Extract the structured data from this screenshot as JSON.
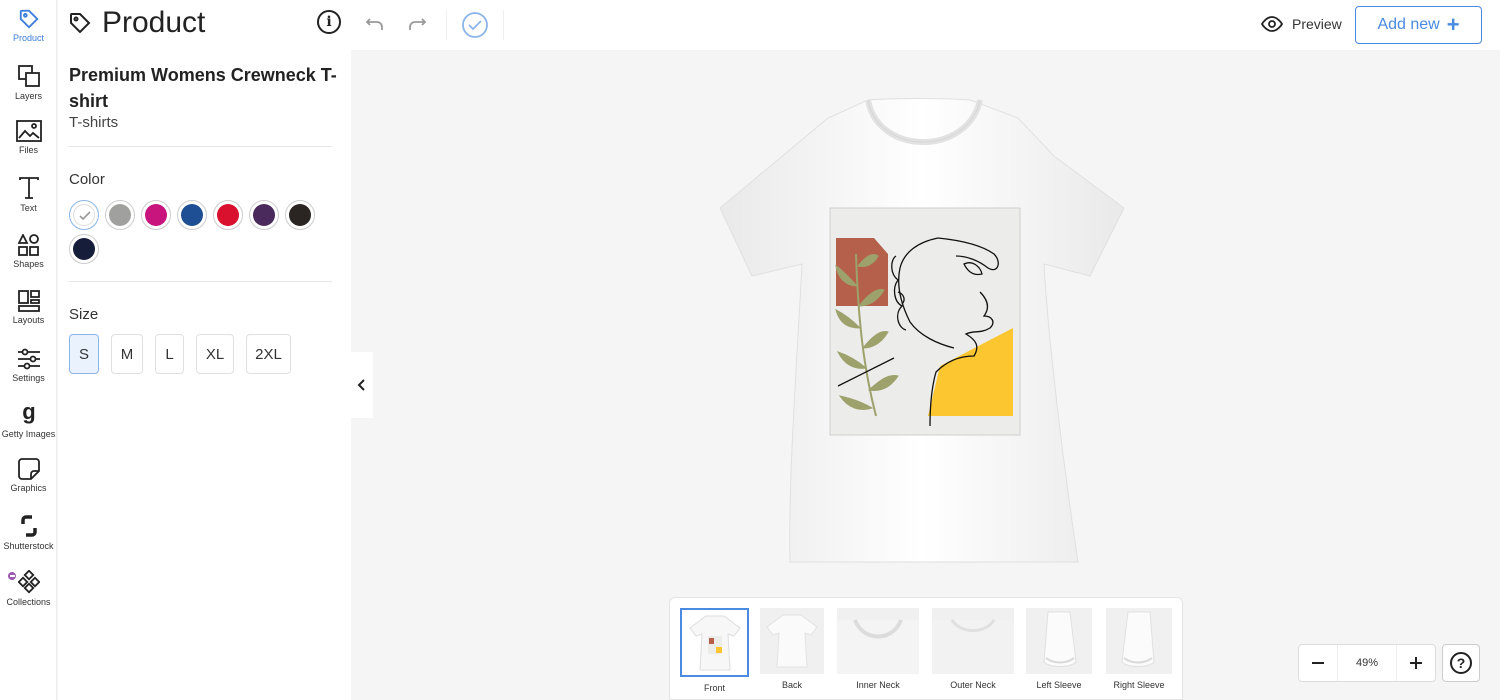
{
  "rail": {
    "items": [
      {
        "label": "Product",
        "icon": "tag-icon",
        "active": true
      },
      {
        "label": "Layers",
        "icon": "layers-icon"
      },
      {
        "label": "Files",
        "icon": "image-icon"
      },
      {
        "label": "Text",
        "icon": "text-icon"
      },
      {
        "label": "Shapes",
        "icon": "shapes-icon"
      },
      {
        "label": "Layouts",
        "icon": "layouts-icon"
      },
      {
        "label": "Settings",
        "icon": "sliders-icon"
      },
      {
        "label": "Getty Images",
        "icon": "getty-icon"
      },
      {
        "label": "Graphics",
        "icon": "sticker-icon"
      },
      {
        "label": "Shutterstock",
        "icon": "shutterstock-icon"
      },
      {
        "label": "Collections",
        "icon": "collections-icon"
      }
    ]
  },
  "panel": {
    "title": "Product",
    "product_name": "Premium Womens Crewneck T-shirt",
    "category": "T-shirts",
    "color_label": "Color",
    "colors": [
      "#ffffff",
      "#a0a09e",
      "#c8157e",
      "#1e4f94",
      "#d9102e",
      "#4a2a5c",
      "#2a2422",
      "#161d3b"
    ],
    "selected_color": "#ffffff",
    "size_label": "Size",
    "sizes": [
      "S",
      "M",
      "L",
      "XL",
      "2XL"
    ],
    "selected_size": "S"
  },
  "topbar": {
    "preview_label": "Preview",
    "add_new_label": "Add new",
    "accent": "#4a8ae0"
  },
  "design_colors": {
    "terracotta": "#b5604a",
    "olive": "#9da16b",
    "yellow": "#fcc630"
  },
  "views": [
    {
      "label": "Front",
      "selected": true
    },
    {
      "label": "Back"
    },
    {
      "label": "Inner Neck"
    },
    {
      "label": "Outer Neck"
    },
    {
      "label": "Left Sleeve"
    },
    {
      "label": "Right Sleeve"
    }
  ],
  "zoom": {
    "value": "49%"
  }
}
